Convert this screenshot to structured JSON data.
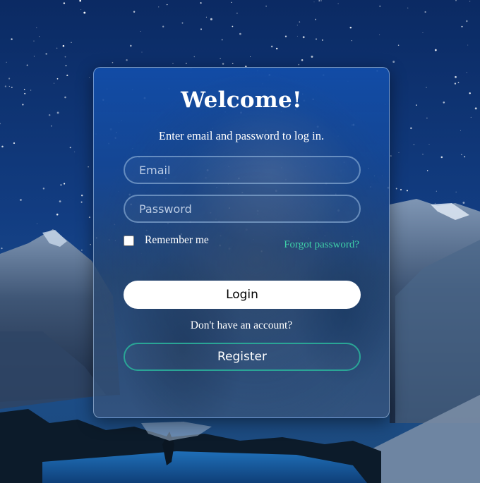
{
  "login_card": {
    "title": "Welcome!",
    "subtitle": "Enter email and password to log in.",
    "email_placeholder": "Email",
    "email_value": "",
    "password_placeholder": "Password",
    "password_value": "",
    "remember_label": "Remember me",
    "remember_checked": false,
    "forgot_link": "Forgot password?",
    "login_label": "Login",
    "no_account_text": "Don't have an account?",
    "register_label": "Register"
  },
  "icons": {
    "checkbox": "checkbox-unchecked"
  },
  "colors": {
    "accent_link": "#3fd0a8",
    "register_border": "#2aa596",
    "card_tint": "#1650a8"
  }
}
